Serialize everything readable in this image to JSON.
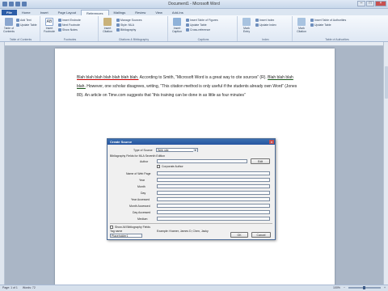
{
  "window": {
    "title": "Document1 - Microsoft Word"
  },
  "tabs": [
    {
      "label": "File"
    },
    {
      "label": "Home"
    },
    {
      "label": "Insert"
    },
    {
      "label": "Page Layout"
    },
    {
      "label": "References"
    },
    {
      "label": "Mailings"
    },
    {
      "label": "Review"
    },
    {
      "label": "View"
    },
    {
      "label": "Add-Ins"
    }
  ],
  "ribbon": {
    "toc": {
      "big": "Table of Contents",
      "add_text": "Add Text",
      "update": "Update Table",
      "group": "Table of Contents"
    },
    "footnotes": {
      "insert": "Insert Footnote",
      "endnote": "Insert Endnote",
      "next": "Next Footnote",
      "show": "Show Notes",
      "group": "Footnotes"
    },
    "citations": {
      "insert": "Insert Citation",
      "manage": "Manage Sources",
      "style_label": "Style:",
      "style_value": "MLA",
      "bib": "Bibliography",
      "group": "Citations & Bibliography"
    },
    "captions": {
      "insert": "Insert Caption",
      "tof": "Insert Table of Figures",
      "update": "Update Table",
      "cross": "Cross-reference",
      "group": "Captions"
    },
    "index": {
      "mark": "Mark Entry",
      "insert": "Insert Index",
      "update": "Update Index",
      "group": "Index"
    },
    "toa": {
      "mark": "Mark Citation",
      "insert": "Insert Table of Authorities",
      "update": "Update Table",
      "group": "Table of Authorities"
    }
  },
  "document": {
    "s1": "Blah blah blah blah blah blah blah.",
    "s2": " According to Smith, “Microsoft Word is a great way to cite sources” (R). ",
    "s3": "Blah blah blah blah.",
    "s4": " However, one scholar disagrees, writing, “This citation method is only useful if the students already own Word” (Jones 80). An article on Time.com suggests that “this training can be done in as little as four minutes”"
  },
  "dialog": {
    "title": "Create Source",
    "type_label": "Type of Source",
    "type_value": "Web site",
    "fields_header": "Bibliography Fields for MLA Seventh Edition",
    "author_label": "Author",
    "edit_label": "Edit",
    "corporate_label": "Corporate Author",
    "rows": [
      {
        "label": "Name of Web Page"
      },
      {
        "label": "Year"
      },
      {
        "label": "Month"
      },
      {
        "label": "Day"
      },
      {
        "label": "Year Accessed"
      },
      {
        "label": "Month Accessed"
      },
      {
        "label": "Day Accessed"
      },
      {
        "label": "Medium"
      }
    ],
    "show_all_label": "Show All Bibliography Fields",
    "tag_label": "Tag name",
    "tag_value": "Placeholder1",
    "example_label": "Example: Kramer, James D; Chen, Jacky",
    "ok_label": "OK",
    "cancel_label": "Cancel"
  },
  "status": {
    "page": "Page: 1 of 1",
    "words": "Words: 72",
    "zoom": "100%"
  },
  "colors": {
    "file_tab": "#2d5ea8",
    "dialog_title": "#2654a0",
    "close": "#c75050"
  }
}
